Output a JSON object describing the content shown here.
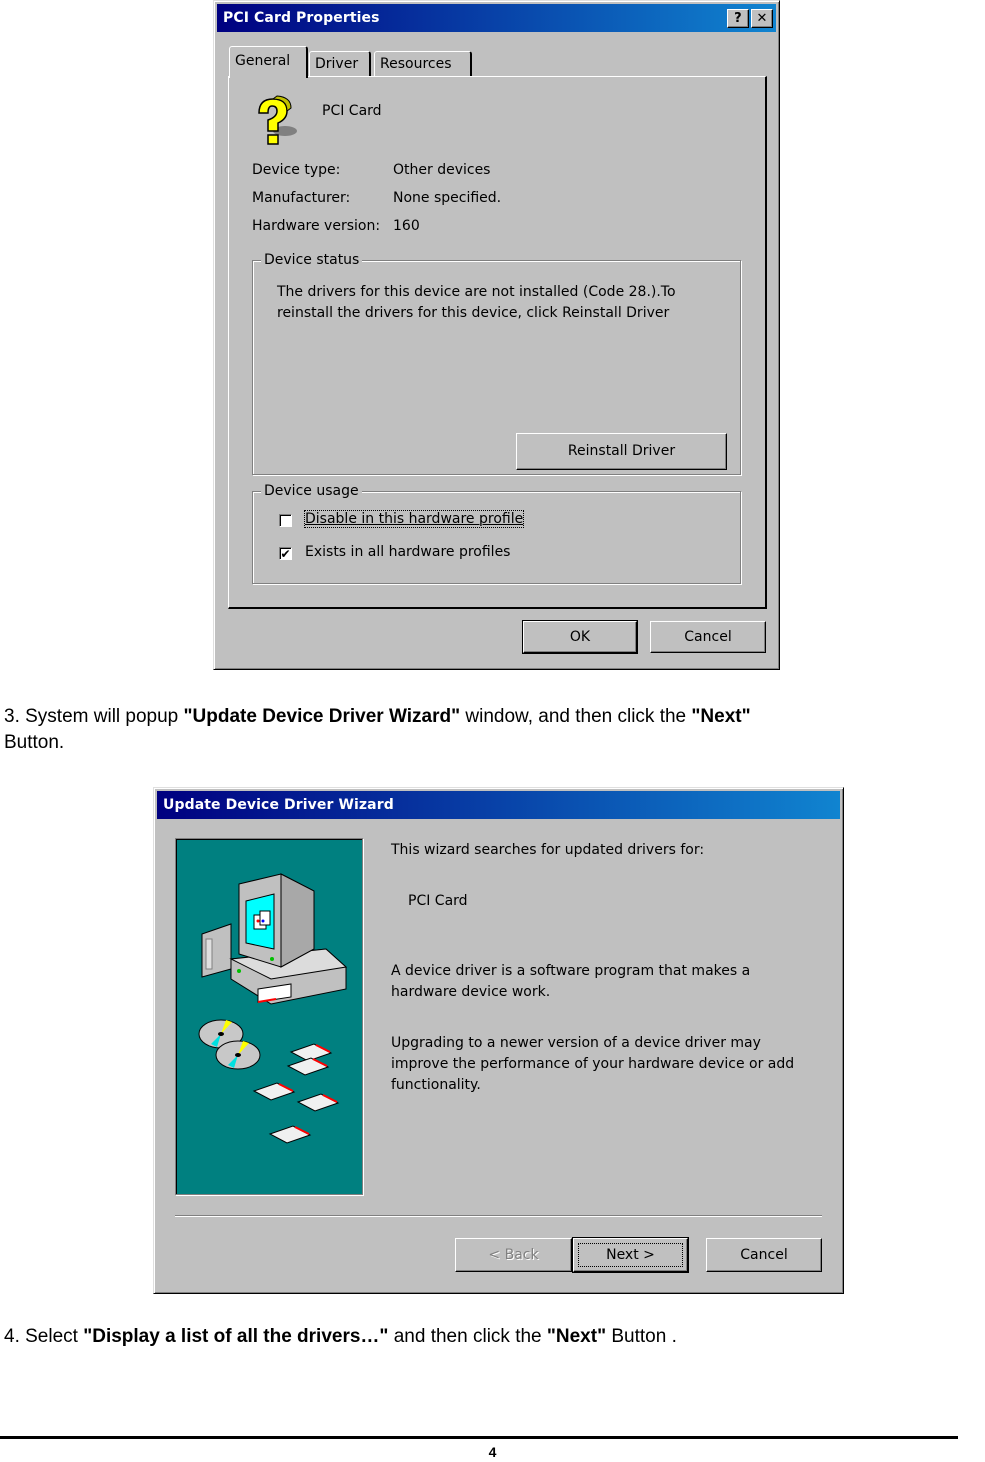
{
  "dialog1": {
    "title": "PCI Card Properties",
    "help_btn": "?",
    "close_btn": "✕",
    "tabs": [
      {
        "label": "General",
        "active": true
      },
      {
        "label": "Driver",
        "active": false
      },
      {
        "label": "Resources",
        "active": false
      }
    ],
    "device_name": "PCI Card",
    "device_icon": "question-mark-icon",
    "properties": [
      {
        "label": "Device type:",
        "value": "Other devices"
      },
      {
        "label": "Manufacturer:",
        "value": "None specified."
      },
      {
        "label": "Hardware version:",
        "value": "160"
      }
    ],
    "device_status": {
      "label": "Device status",
      "line1": "The drivers for this device are not installed  (Code 28.).To",
      "line2": "reinstall the drivers for this device, click Reinstall Driver",
      "reinstall_btn": "Reinstall Driver"
    },
    "device_usage": {
      "label": "Device usage",
      "options": [
        {
          "label": "Disable in this hardware profile",
          "checked": false,
          "check_mark": ""
        },
        {
          "label": "Exists in all hardware profiles",
          "checked": true,
          "check_mark": "✔"
        }
      ]
    },
    "ok_btn": "OK",
    "cancel_btn": "Cancel"
  },
  "step3": {
    "prefix": "3. System will popup ",
    "bold1": "\"Update Device Driver Wizard\"",
    "middle": " window, and then click the ",
    "bold2": "\"Next\"",
    "suffix": "Button."
  },
  "dialog2": {
    "title": "Update Device Driver Wizard",
    "intro": "This wizard searches for updated drivers for:",
    "device_name": "PCI Card",
    "para1_line1": "A device driver is a software program that makes a",
    "para1_line2": "hardware device work.",
    "para2_line1": "Upgrading to a newer version of a device driver may",
    "para2_line2": "improve the performance of your hardware device or add",
    "para2_line3": "functionality.",
    "illustration": "computer-with-disks-illustration",
    "back_btn": "< Back",
    "next_btn": "Next >",
    "cancel_btn": "Cancel"
  },
  "step4": {
    "prefix": "4. Select ",
    "bold1": "\"Display a list of all the drivers…\"",
    "middle": " and then click the ",
    "bold2": "\"Next\"",
    "suffix": " Button ."
  },
  "footer": {
    "page_number": "4"
  }
}
